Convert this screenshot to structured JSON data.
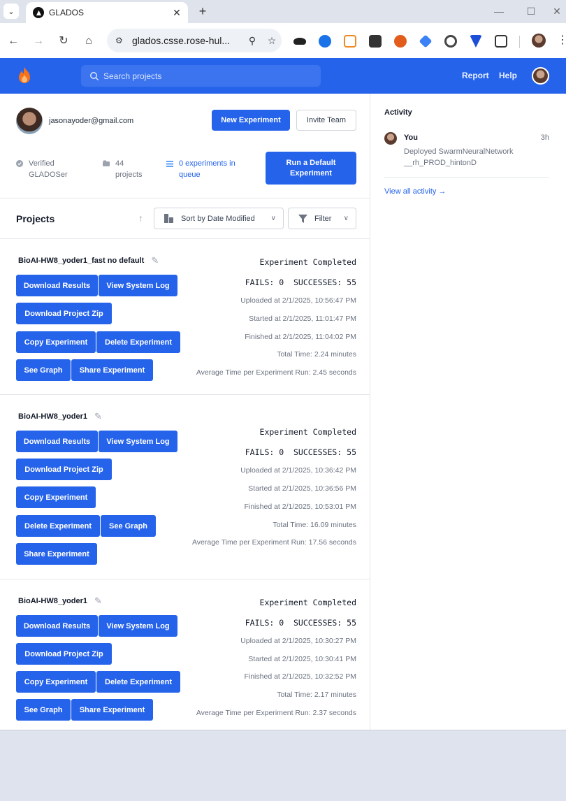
{
  "browser": {
    "tab_title": "GLADOS",
    "url": "glados.csse.rose-hul...",
    "colors": {
      "tabstrip": "#dfe3ec"
    }
  },
  "header": {
    "search_placeholder": "Search projects",
    "links": [
      "Report",
      "Help"
    ],
    "colors": {
      "brand": "#2563eb"
    }
  },
  "profile": {
    "email": "jasonayoder@gmail.com",
    "new_experiment": "New Experiment",
    "invite_team": "Invite Team",
    "stats": {
      "verified_line1": "Verified",
      "verified_line2": "GLADOSer",
      "projects_line1": "44",
      "projects_line2": "projects",
      "queue_line1": "0 experiments in",
      "queue_line2": "queue"
    },
    "run_default_line1": "Run a Default",
    "run_default_line2": "Experiment"
  },
  "projects_header": {
    "title": "Projects",
    "sort_label": "Sort by Date Modified",
    "filter_label": "Filter"
  },
  "projects": [
    {
      "name": "BioAI-HW8_yoder1_fast no default",
      "status": "Experiment Completed",
      "counts": "FAILS: 0  SUCCESSES: 55",
      "uploaded": "Uploaded at 2/1/2025, 10:56:47 PM",
      "started": "Started at 2/1/2025, 11:01:47 PM",
      "finished": "Finished at 2/1/2025, 11:04:02 PM",
      "total": "Total Time: 2.24 minutes",
      "average": "Average Time per Experiment Run: 2.45 seconds",
      "buttons": {
        "download_results": "Download Results",
        "view_log": "View System Log",
        "download_zip": "Download Project Zip",
        "copy": "Copy Experiment",
        "delete": "Delete Experiment",
        "graph": "See Graph",
        "share": "Share Experiment"
      }
    },
    {
      "name": "BioAI-HW8_yoder1",
      "status": "Experiment Completed",
      "counts": "FAILS: 0  SUCCESSES: 55",
      "uploaded": "Uploaded at 2/1/2025, 10:36:42 PM",
      "started": "Started at 2/1/2025, 10:36:56 PM",
      "finished": "Finished at 2/1/2025, 10:53:01 PM",
      "total": "Total Time: 16.09 minutes",
      "average": "Average Time per Experiment Run: 17.56 seconds",
      "buttons": {
        "download_results": "Download Results",
        "view_log": "View System Log",
        "download_zip": "Download Project Zip",
        "copy": "Copy Experiment",
        "delete": "Delete Experiment",
        "graph": "See Graph",
        "share": "Share Experiment"
      }
    },
    {
      "name": "BioAI-HW8_yoder1",
      "status": "Experiment Completed",
      "counts": "FAILS: 0  SUCCESSES: 55",
      "uploaded": "Uploaded at 2/1/2025, 10:30:27 PM",
      "started": "Started at 2/1/2025, 10:30:41 PM",
      "finished": "Finished at 2/1/2025, 10:32:52 PM",
      "total": "Total Time: 2.17 minutes",
      "average": "Average Time per Experiment Run: 2.37 seconds",
      "buttons": {
        "download_results": "Download Results",
        "view_log": "View System Log",
        "download_zip": "Download Project Zip",
        "copy": "Copy Experiment",
        "delete": "Delete Experiment",
        "graph": "See Graph",
        "share": "Share Experiment"
      }
    }
  ],
  "activity": {
    "title": "Activity",
    "user": "You",
    "time": "3h",
    "desc_line1": "Deployed SwarmNeuralNetwork",
    "desc_line2": "__rh_PROD_hintonD",
    "view_all": "View all activity →"
  }
}
